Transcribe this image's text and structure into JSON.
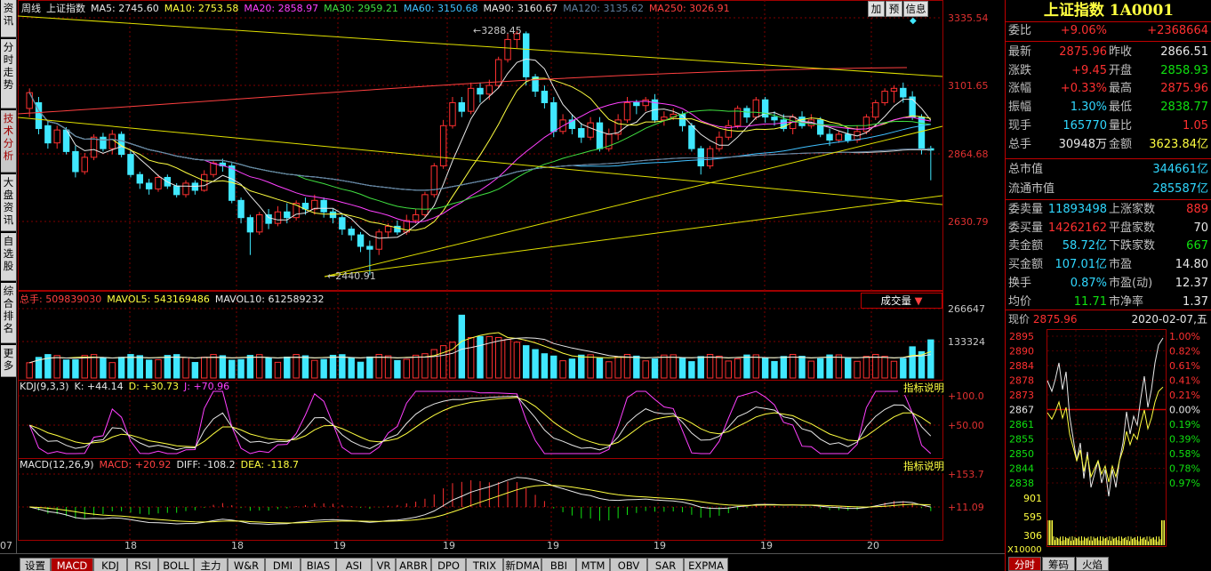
{
  "left_nav": [
    {
      "label": "资讯",
      "active": false
    },
    {
      "label": "分时走势",
      "active": false
    },
    {
      "label": "技术分析",
      "active": true
    },
    {
      "label": "大盘资讯",
      "active": false
    },
    {
      "label": "自选股",
      "active": false
    },
    {
      "label": "综合排名",
      "active": false
    },
    {
      "label": "更多",
      "active": false
    }
  ],
  "main_header": {
    "period": "周线",
    "name": "上证指数",
    "ma": [
      {
        "label": "MA5: 2745.60",
        "color": "#e8e8e8"
      },
      {
        "label": "MA10: 2753.58",
        "color": "#ffff40"
      },
      {
        "label": "MA20: 2858.97",
        "color": "#ff40ff"
      },
      {
        "label": "MA30: 2959.21",
        "color": "#40e040"
      },
      {
        "label": "MA60: 3150.68",
        "color": "#40c0ff"
      },
      {
        "label": "MA90: 3160.67",
        "color": "#e8e8e8"
      },
      {
        "label": "MA120: 3135.62",
        "color": "#6080a0"
      },
      {
        "label": "MA250: 3026.91",
        "color": "#ff4040"
      }
    ],
    "buttons": [
      "加",
      "预",
      "信息"
    ]
  },
  "price_axis": [
    "3335.54",
    "3101.65",
    "2864.68",
    "2630.79"
  ],
  "price_annotations": {
    "high": "3288.45",
    "low": "2440.91"
  },
  "volume_header": {
    "items": [
      {
        "label": "总手: 509839030",
        "color": "#ff4040"
      },
      {
        "label": "MAVOL5: 543169486",
        "color": "#ffff40"
      },
      {
        "label": "MAVOL10: 612589232",
        "color": "#e8e8e8"
      }
    ],
    "selector": "成交量"
  },
  "volume_axis": [
    "266647",
    "133324"
  ],
  "kdj_header": {
    "items": [
      {
        "label": "KDJ(9,3,3)",
        "color": "#e8e8e8"
      },
      {
        "label": "K: +44.14",
        "color": "#e8e8e8"
      },
      {
        "label": "D: +30.73",
        "color": "#ffff40"
      },
      {
        "label": "J: +70.96",
        "color": "#ff40ff"
      }
    ],
    "help": "指标说明"
  },
  "kdj_axis": [
    "+100.0",
    "+50.00"
  ],
  "macd_header": {
    "items": [
      {
        "label": "MACD(12,26,9)",
        "color": "#e8e8e8"
      },
      {
        "label": "MACD: +20.92",
        "color": "#ff4040"
      },
      {
        "label": "DIFF: -108.2",
        "color": "#e8e8e8"
      },
      {
        "label": "DEA: -118.7",
        "color": "#ffff40"
      }
    ],
    "help": "指标说明"
  },
  "macd_axis": [
    "+153.7",
    "+11.09"
  ],
  "x_axis": [
    "07",
    "18",
    "18",
    "19",
    "19",
    "19",
    "19",
    "19",
    "20"
  ],
  "bottom_tabs": [
    "设置",
    "MACD",
    "KDJ",
    "RSI",
    "BOLL",
    "主力",
    "W&R",
    "DMI",
    "BIAS",
    "ASI",
    "VR",
    "ARBR",
    "DPO",
    "TRIX",
    "新DMA",
    "BBI",
    "MTM",
    "OBV",
    "SAR",
    "EXPMA"
  ],
  "bottom_active": "MACD",
  "quote": {
    "title": "上证指数 1A0001",
    "weibi": {
      "label": "委比",
      "v1": "+9.06%",
      "v2": "+2368664"
    },
    "rows": [
      {
        "l1": "最新",
        "v1": "2875.96",
        "c1": "red",
        "l2": "昨收",
        "v2": "2866.51",
        "c2": "wht"
      },
      {
        "l1": "涨跌",
        "v1": "+9.45",
        "c1": "red",
        "l2": "开盘",
        "v2": "2858.93",
        "c2": "grn"
      },
      {
        "l1": "涨幅",
        "v1": "+0.33%",
        "c1": "red",
        "l2": "最高",
        "v2": "2875.96",
        "c2": "red"
      },
      {
        "l1": "振幅",
        "v1": "1.30%",
        "c1": "cyan",
        "l2": "最低",
        "v2": "2838.77",
        "c2": "grn"
      },
      {
        "l1": "现手",
        "v1": "165770",
        "c1": "cyan",
        "l2": "量比",
        "v2": "1.05",
        "c2": "red"
      },
      {
        "l1": "总手",
        "v1": "30948万",
        "c1": "wht",
        "l2": "金额",
        "v2": "3623.84亿",
        "c2": "yel"
      }
    ],
    "mkt": [
      {
        "label": "总市值",
        "value": "344661亿"
      },
      {
        "label": "流通市值",
        "value": "285587亿"
      }
    ],
    "rows2": [
      {
        "l1": "委卖量",
        "v1": "11893498",
        "c1": "cyan",
        "l2": "上涨家数",
        "v2": "889",
        "c2": "red"
      },
      {
        "l1": "委买量",
        "v1": "14262162",
        "c1": "red",
        "l2": "平盘家数",
        "v2": "70",
        "c2": "wht"
      },
      {
        "l1": "卖金额",
        "v1": "58.72亿",
        "c1": "cyan",
        "l2": "下跌家数",
        "v2": "667",
        "c2": "grn"
      },
      {
        "l1": "买金额",
        "v1": "107.01亿",
        "c1": "cyan",
        "l2": "市盈",
        "v2": "14.80",
        "c2": "wht"
      },
      {
        "l1": "换手",
        "v1": "0.87%",
        "c1": "cyan",
        "l2": "市盈(动)",
        "v2": "12.37",
        "c2": "wht"
      },
      {
        "l1": "均价",
        "v1": "11.71",
        "c1": "grn",
        "l2": "市净率",
        "v2": "1.37",
        "c2": "wht"
      }
    ],
    "now_label": "现价",
    "now_value": "2875.96",
    "date": "2020-02-07,五"
  },
  "mini_left_axis": [
    "2895",
    "2890",
    "2884",
    "2878",
    "2873",
    "2867",
    "2861",
    "2855",
    "2850",
    "2844",
    "2838"
  ],
  "mini_right_axis": [
    "1.00%",
    "0.82%",
    "0.61%",
    "0.41%",
    "0.21%",
    "0.00%",
    "0.19%",
    "0.39%",
    "0.58%",
    "0.78%",
    "0.97%"
  ],
  "mini_vol_axis": [
    "901",
    "595",
    "306",
    "X10000"
  ],
  "right_tabs": [
    "分时",
    "筹码",
    "火焰"
  ],
  "right_active": "分时",
  "chart_data": {
    "type": "candlestick",
    "ylim": [
      2440.91,
      3335.54
    ],
    "candles": [
      [
        3020,
        3075,
        2990,
        3090
      ],
      [
        3040,
        2950,
        2930,
        3060
      ],
      [
        2960,
        2900,
        2880,
        2975
      ],
      [
        2900,
        2945,
        2880,
        2960
      ],
      [
        2945,
        2870,
        2860,
        2955
      ],
      [
        2870,
        2800,
        2780,
        2890
      ],
      [
        2800,
        2850,
        2790,
        2865
      ],
      [
        2850,
        2920,
        2840,
        2930
      ],
      [
        2920,
        2880,
        2870,
        2935
      ],
      [
        2880,
        2930,
        2860,
        2945
      ],
      [
        2930,
        2860,
        2850,
        2940
      ],
      [
        2860,
        2790,
        2780,
        2875
      ],
      [
        2790,
        2760,
        2740,
        2800
      ],
      [
        2760,
        2740,
        2720,
        2775
      ],
      [
        2740,
        2780,
        2730,
        2790
      ],
      [
        2780,
        2750,
        2740,
        2790
      ],
      [
        2750,
        2720,
        2710,
        2760
      ],
      [
        2720,
        2760,
        2710,
        2770
      ],
      [
        2760,
        2735,
        2720,
        2770
      ],
      [
        2735,
        2790,
        2730,
        2805
      ],
      [
        2790,
        2830,
        2780,
        2840
      ],
      [
        2830,
        2820,
        2800,
        2845
      ],
      [
        2820,
        2700,
        2690,
        2830
      ],
      [
        2700,
        2640,
        2620,
        2710
      ],
      [
        2640,
        2590,
        2510,
        2650
      ],
      [
        2590,
        2650,
        2580,
        2660
      ],
      [
        2650,
        2620,
        2600,
        2670
      ],
      [
        2620,
        2660,
        2610,
        2680
      ],
      [
        2660,
        2640,
        2620,
        2690
      ],
      [
        2640,
        2690,
        2630,
        2700
      ],
      [
        2690,
        2670,
        2650,
        2710
      ],
      [
        2670,
        2700,
        2650,
        2720
      ],
      [
        2700,
        2660,
        2640,
        2710
      ],
      [
        2660,
        2640,
        2620,
        2670
      ],
      [
        2640,
        2600,
        2580,
        2650
      ],
      [
        2600,
        2580,
        2560,
        2610
      ],
      [
        2580,
        2540,
        2520,
        2590
      ],
      [
        2540,
        2530,
        2440,
        2560
      ],
      [
        2530,
        2590,
        2510,
        2600
      ],
      [
        2590,
        2610,
        2570,
        2620
      ],
      [
        2610,
        2590,
        2580,
        2630
      ],
      [
        2590,
        2630,
        2580,
        2650
      ],
      [
        2630,
        2650,
        2620,
        2670
      ],
      [
        2650,
        2720,
        2640,
        2730
      ],
      [
        2720,
        2820,
        2710,
        2830
      ],
      [
        2820,
        2960,
        2810,
        2980
      ],
      [
        2960,
        3040,
        2950,
        3060
      ],
      [
        3040,
        3010,
        2990,
        3060
      ],
      [
        3010,
        3090,
        3000,
        3110
      ],
      [
        3090,
        3070,
        3040,
        3110
      ],
      [
        3070,
        3100,
        3050,
        3120
      ],
      [
        3100,
        3190,
        3090,
        3200
      ],
      [
        3190,
        3260,
        3180,
        3280
      ],
      [
        3260,
        3280,
        3230,
        3290
      ],
      [
        3280,
        3130,
        3100,
        3288
      ],
      [
        3130,
        3080,
        3060,
        3140
      ],
      [
        3080,
        3040,
        3020,
        3100
      ],
      [
        3040,
        2940,
        2920,
        3060
      ],
      [
        2940,
        2980,
        2930,
        3000
      ],
      [
        2980,
        2950,
        2930,
        3000
      ],
      [
        2950,
        2920,
        2900,
        2970
      ],
      [
        2920,
        2970,
        2910,
        2990
      ],
      [
        2970,
        2880,
        2870,
        2990
      ],
      [
        2880,
        2930,
        2870,
        2950
      ],
      [
        2930,
        2980,
        2910,
        3000
      ],
      [
        2980,
        3040,
        2970,
        3060
      ],
      [
        3040,
        3030,
        3000,
        3050
      ],
      [
        3030,
        3050,
        3010,
        3060
      ],
      [
        3050,
        2980,
        2970,
        3070
      ],
      [
        2980,
        2990,
        2960,
        3010
      ],
      [
        2990,
        3000,
        2980,
        3020
      ],
      [
        3000,
        2960,
        2940,
        3010
      ],
      [
        2960,
        2880,
        2870,
        2970
      ],
      [
        2880,
        2820,
        2790,
        2890
      ],
      [
        2820,
        2880,
        2810,
        2890
      ],
      [
        2880,
        2920,
        2870,
        2940
      ],
      [
        2920,
        2960,
        2910,
        2980
      ],
      [
        2960,
        3020,
        2950,
        3030
      ],
      [
        3020,
        2990,
        2970,
        3030
      ],
      [
        2990,
        3050,
        2980,
        3060
      ],
      [
        3050,
        2990,
        2970,
        3060
      ],
      [
        2990,
        2980,
        2960,
        3010
      ],
      [
        2980,
        2950,
        2940,
        3000
      ],
      [
        2950,
        2990,
        2930,
        3000
      ],
      [
        2990,
        2960,
        2950,
        3010
      ],
      [
        2960,
        2980,
        2950,
        3000
      ],
      [
        2980,
        2930,
        2920,
        2990
      ],
      [
        2930,
        2910,
        2890,
        2950
      ],
      [
        2910,
        2930,
        2900,
        2940
      ],
      [
        2930,
        2910,
        2900,
        2950
      ],
      [
        2910,
        2940,
        2900,
        2960
      ],
      [
        2940,
        2990,
        2930,
        3000
      ],
      [
        2990,
        3040,
        2980,
        3050
      ],
      [
        3040,
        3080,
        3030,
        3090
      ],
      [
        3080,
        3090,
        3040,
        3100
      ],
      [
        3090,
        3060,
        3040,
        3110
      ],
      [
        3060,
        2990,
        2980,
        3080
      ],
      [
        2990,
        2880,
        2860,
        3000
      ],
      [
        2880,
        2875,
        2770,
        2890
      ]
    ]
  }
}
